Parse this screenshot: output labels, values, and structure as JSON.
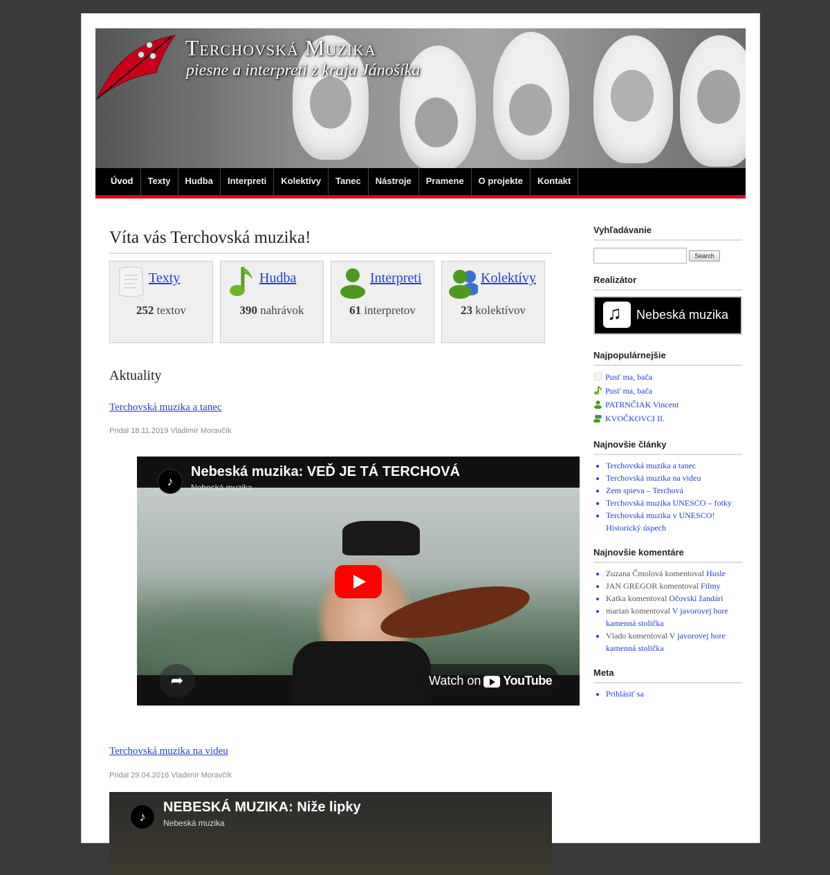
{
  "site": {
    "title": "Terchovská Muzika",
    "subtitle": "piesne a interpreti z kraja Jánošíka"
  },
  "nav": {
    "items": [
      {
        "label": "Úvod",
        "active": true
      },
      {
        "label": "Texty"
      },
      {
        "label": "Hudba"
      },
      {
        "label": "Interpreti"
      },
      {
        "label": "Kolektívy"
      },
      {
        "label": "Tanec"
      },
      {
        "label": "Nástroje"
      },
      {
        "label": "Pramene"
      },
      {
        "label": "O projekte"
      },
      {
        "label": "Kontakt"
      }
    ]
  },
  "main": {
    "title": "Víta vás Terchovská muzika!",
    "stats": [
      {
        "label": "Texty",
        "count": "252",
        "unit": "textov",
        "icon": "document-icon"
      },
      {
        "label": "Hudba",
        "count": "390",
        "unit": "nahrávok",
        "icon": "music-note-icon"
      },
      {
        "label": "Interpreti",
        "count": "61",
        "unit": "interpretov",
        "icon": "person-icon"
      },
      {
        "label": "Kolektívy",
        "count": "23",
        "unit": "kolektívov",
        "icon": "group-icon"
      }
    ],
    "news_heading": "Aktuality",
    "posts": [
      {
        "title": "Terchovská muzika a tanec",
        "meta": "Pridal 18.11.2019 Vladimír Moravčík",
        "video": {
          "title": "Nebeská muzika: VEĎ JE TÁ TERCHOVÁ",
          "channel": "Nebeská muzika",
          "watch_label": "Watch on",
          "brand": "YouTube"
        }
      },
      {
        "title": "Terchovská muzika na videu",
        "meta": "Pridal 29.04.2016 Vladimír Moravčík",
        "video": {
          "title": "NEBESKÁ MUZIKA: Niže lipky",
          "channel": "Nebeská muzika"
        }
      }
    ]
  },
  "sidebar": {
    "search": {
      "title": "Vyhľadávanie",
      "placeholder": "",
      "button": "Search"
    },
    "realizer": {
      "title": "Realizátor",
      "badge": "Nebeská muzika"
    },
    "popular": {
      "title": "Najpopulárnejšie",
      "items": [
        {
          "label": "Pusť ma, bača",
          "icon": "document-icon"
        },
        {
          "label": "Pusť ma, bača",
          "icon": "music-note-icon"
        },
        {
          "label": "PATRNČIAK Vincent",
          "icon": "person-icon"
        },
        {
          "label": "KVOČKOVCI II.",
          "icon": "group-icon"
        }
      ]
    },
    "recent_posts": {
      "title": "Najnovšie články",
      "items": [
        "Terchovská muzika a tanec",
        "Terchovská muzika na videu",
        "Zem spieva – Terchová",
        "Terchovská muzika UNESCO – fotky",
        "Terchovská muzika v UNESCO! Historický úspech"
      ]
    },
    "recent_comments": {
      "title": "Najnovšie komentáre",
      "items": [
        {
          "author": "Zuzana Čmolová",
          "verb": "komentoval",
          "post": "Husle"
        },
        {
          "author": "JAN GREGOR",
          "verb": "komentoval",
          "post": "Filmy"
        },
        {
          "author": "Katka",
          "verb": "komentoval",
          "post": "Očovskí žandári"
        },
        {
          "author": "marian",
          "verb": "komentoval",
          "post": "V javorovej hore kamenná stolička"
        },
        {
          "author": "Vlado",
          "verb": "komentoval",
          "post": "V javorovej hore kamenná stolička"
        }
      ]
    },
    "meta": {
      "title": "Meta",
      "items": [
        "Prihlásiť sa"
      ]
    }
  }
}
